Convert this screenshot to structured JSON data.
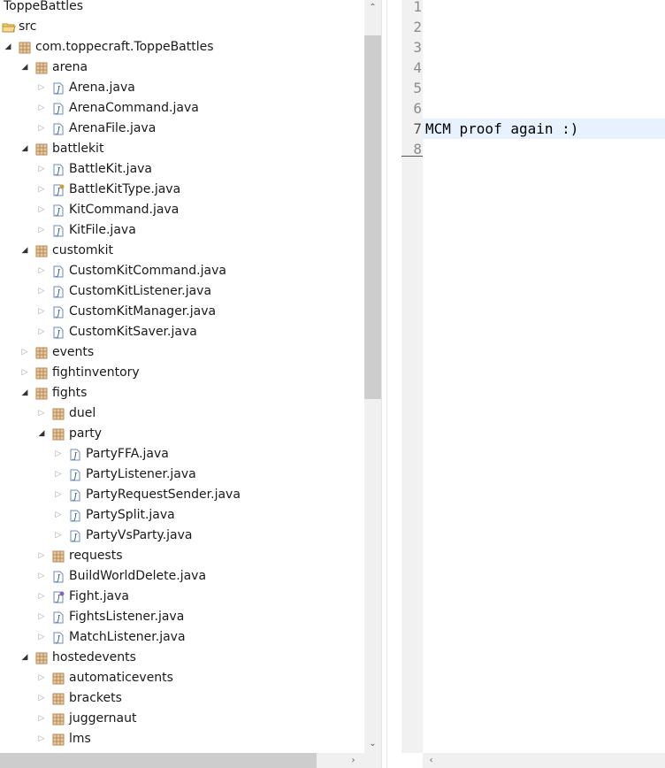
{
  "explorer": {
    "rows": [
      {
        "level": 0,
        "arrow": "none",
        "icon": "project",
        "label": "ToppeBattles"
      },
      {
        "level": 0,
        "arrow": "none",
        "icon": "folder",
        "label": "src"
      },
      {
        "level": 1,
        "arrow": "expanded",
        "icon": "package",
        "label": "com.toppecraft.ToppeBattles"
      },
      {
        "level": 2,
        "arrow": "expanded",
        "icon": "package",
        "label": "arena"
      },
      {
        "level": 3,
        "arrow": "collapsed",
        "icon": "java",
        "label": "Arena.java"
      },
      {
        "level": 3,
        "arrow": "collapsed",
        "icon": "java",
        "label": "ArenaCommand.java"
      },
      {
        "level": 3,
        "arrow": "collapsed",
        "icon": "java",
        "label": "ArenaFile.java"
      },
      {
        "level": 2,
        "arrow": "expanded",
        "icon": "package",
        "label": "battlekit"
      },
      {
        "level": 3,
        "arrow": "collapsed",
        "icon": "java",
        "label": "BattleKit.java"
      },
      {
        "level": 3,
        "arrow": "collapsed",
        "icon": "java-enum",
        "label": "BattleKitType.java"
      },
      {
        "level": 3,
        "arrow": "collapsed",
        "icon": "java",
        "label": "KitCommand.java"
      },
      {
        "level": 3,
        "arrow": "collapsed",
        "icon": "java",
        "label": "KitFile.java"
      },
      {
        "level": 2,
        "arrow": "expanded",
        "icon": "package",
        "label": "customkit"
      },
      {
        "level": 3,
        "arrow": "collapsed",
        "icon": "java",
        "label": "CustomKitCommand.java"
      },
      {
        "level": 3,
        "arrow": "collapsed",
        "icon": "java",
        "label": "CustomKitListener.java"
      },
      {
        "level": 3,
        "arrow": "collapsed",
        "icon": "java",
        "label": "CustomKitManager.java"
      },
      {
        "level": 3,
        "arrow": "collapsed",
        "icon": "java",
        "label": "CustomKitSaver.java"
      },
      {
        "level": 2,
        "arrow": "collapsed",
        "icon": "package",
        "label": "events"
      },
      {
        "level": 2,
        "arrow": "collapsed",
        "icon": "package",
        "label": "fightinventory"
      },
      {
        "level": 2,
        "arrow": "expanded",
        "icon": "package",
        "label": "fights"
      },
      {
        "level": 3,
        "arrow": "collapsed",
        "icon": "package",
        "label": "duel"
      },
      {
        "level": 3,
        "arrow": "expanded",
        "icon": "package",
        "label": "party"
      },
      {
        "level": 4,
        "arrow": "collapsed",
        "icon": "java",
        "label": "PartyFFA.java"
      },
      {
        "level": 4,
        "arrow": "collapsed",
        "icon": "java",
        "label": "PartyListener.java"
      },
      {
        "level": 4,
        "arrow": "collapsed",
        "icon": "java",
        "label": "PartyRequestSender.java"
      },
      {
        "level": 4,
        "arrow": "collapsed",
        "icon": "java",
        "label": "PartySplit.java"
      },
      {
        "level": 4,
        "arrow": "collapsed",
        "icon": "java",
        "label": "PartyVsParty.java"
      },
      {
        "level": 3,
        "arrow": "collapsed",
        "icon": "package",
        "label": "requests"
      },
      {
        "level": 3,
        "arrow": "collapsed",
        "icon": "java",
        "label": "BuildWorldDelete.java"
      },
      {
        "level": 3,
        "arrow": "collapsed",
        "icon": "java-interface",
        "label": "Fight.java"
      },
      {
        "level": 3,
        "arrow": "collapsed",
        "icon": "java",
        "label": "FightsListener.java"
      },
      {
        "level": 3,
        "arrow": "collapsed",
        "icon": "java",
        "label": "MatchListener.java"
      },
      {
        "level": 2,
        "arrow": "expanded",
        "icon": "package",
        "label": "hostedevents"
      },
      {
        "level": 3,
        "arrow": "collapsed",
        "icon": "package",
        "label": "automaticevents"
      },
      {
        "level": 3,
        "arrow": "collapsed",
        "icon": "package",
        "label": "brackets"
      },
      {
        "level": 3,
        "arrow": "collapsed",
        "icon": "package",
        "label": "juggernaut"
      },
      {
        "level": 3,
        "arrow": "collapsed",
        "icon": "package",
        "label": "lms"
      }
    ]
  },
  "editor": {
    "lines": [
      {
        "num": "1",
        "text": ""
      },
      {
        "num": "2",
        "text": ""
      },
      {
        "num": "3",
        "text": ""
      },
      {
        "num": "4",
        "text": ""
      },
      {
        "num": "5",
        "text": ""
      },
      {
        "num": "6",
        "text": ""
      },
      {
        "num": "7",
        "text": "MCM proof again :)"
      },
      {
        "num": "8",
        "text": ""
      }
    ],
    "current_line": 7
  },
  "icons": {
    "scroll_up": "chevron-up-icon",
    "scroll_down": "chevron-down-icon",
    "scroll_right": "chevron-right-icon",
    "scroll_left": "chevron-left-icon"
  },
  "colors": {
    "package": "#b38a57",
    "java_icon_border": "#6b8cb8",
    "current_line": "#e8f2fe"
  }
}
